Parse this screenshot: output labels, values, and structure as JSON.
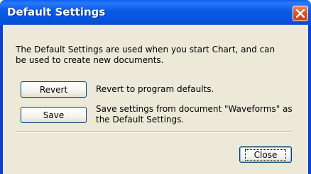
{
  "dialog": {
    "title": "Default Settings",
    "description": "The Default Settings are used when you start Chart, and can be used to create new documents.",
    "close_icon": "close-x-icon"
  },
  "actions": {
    "revert_label": "Revert",
    "revert_description": "Revert to program defaults.",
    "save_label": "Save",
    "save_description": "Save settings from document \"Waveforms\" as the Default Settings."
  },
  "footer": {
    "close_label": "Close"
  },
  "colors": {
    "title_bar": "#0a5ff5",
    "face": "#ece9d8",
    "close_button": "#d8552f"
  }
}
